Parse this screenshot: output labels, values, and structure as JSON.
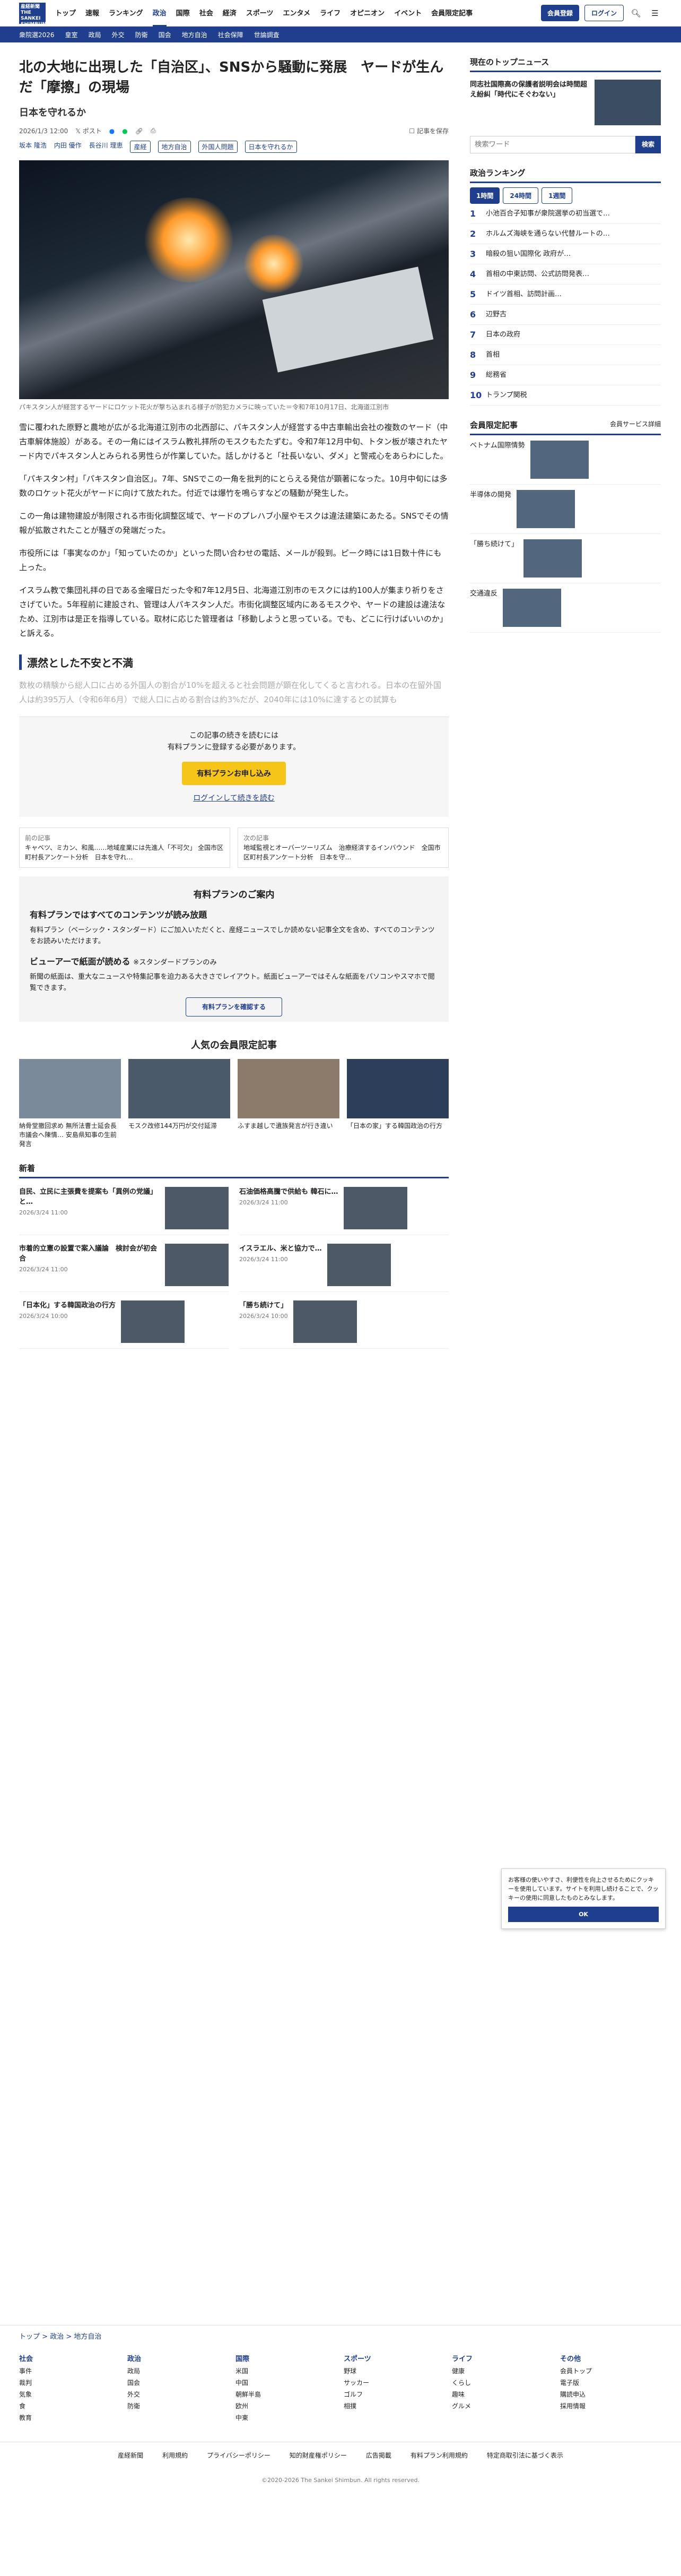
{
  "header": {
    "logo": "産経新聞 THE SANKEI SHIMBUN",
    "nav": [
      "トップ",
      "速報",
      "ランキング",
      "政治",
      "国際",
      "社会",
      "経済",
      "スポーツ",
      "エンタメ",
      "ライフ",
      "オピニオン",
      "イベント",
      "会員限定記事"
    ],
    "register": "会員登録",
    "login": "ログイン",
    "search": "検索",
    "menu": "メニュー"
  },
  "subnav": [
    "衆院選2026",
    "皇室",
    "政局",
    "外交",
    "防衛",
    "国会",
    "地方自治",
    "社会保障",
    "世論調査"
  ],
  "article": {
    "title": "北の大地に出現した「自治区」、SNSから騒動に発展　ヤードが生んだ「摩擦」の現場",
    "series": "日本を守れるか",
    "date": "2026/1/3 12:00",
    "post": "ポスト",
    "note": "記事を保存",
    "authors": [
      "坂本 隆浩",
      "内田 優作",
      "長谷川 理恵"
    ],
    "tags": [
      "産経",
      "地方自治",
      "外国人問題",
      "日本を守れるか"
    ],
    "caption": "パキスタン人が経営するヤードにロケット花火が撃ち込まれる様子が防犯カメラに映っていた＝令和7年10月17日、北海道江別市",
    "paragraphs": [
      "雪に覆われた原野と農地が広がる北海道江別市の北西部に、パキスタン人が経営する中古車輸出会社の複数のヤード（中古車解体施設）がある。その一角にはイスラム教礼拝所のモスクもたたずむ。令和7年12月中旬、トタン板が壊されたヤード内でパキスタン人とみられる男性らが作業していた。話しかけると「社長いない、ダメ」と警戒心をあらわにした。",
      "「パキスタン村」「パキスタン自治区」。7年、SNSでこの一角を批判的にとらえる発信が顕著になった。10月中旬には多数のロケット花火がヤードに向けて放たれた。付近では爆竹を鳴らすなどの騒動が発生した。",
      "この一角は建物建設が制限される市街化調整区域で、ヤードのプレハブ小屋やモスクは違法建築にあたる。SNSでその情報が拡散されたことが騒ぎの発端だった。",
      "市役所には「事実なのか」「知っていたのか」といった問い合わせの電話、メールが殺到。ピーク時には1日数十件にも上った。",
      "イスラム教で集団礼拝の日である金曜日だった令和7年12月5日、北海道江別市のモスクには約100人が集まり祈りをささげていた。5年程前に建設され、管理は人パキスタン人だ。市街化調整区域内にあるモスクや、ヤードの建設は違法なため、江別市は是正を指導している。取材に応じた管理者は「移動しようと思っている。でも、どこに行けばいいのか」と訴える。"
    ],
    "h2": "漂然とした不安と不満",
    "fade": "数枚の精験から総人口に占める外国人の割合が10%を超えると社会問題が顕在化してくると言われる。日本の在留外国人は約395万人（令和6年6月）で総人口に占める割合は約3%だが、2040年には10%に達するとの試算も"
  },
  "paywall": {
    "line1": "この記事の続きを読むには",
    "line2": "有料プランに登録する必要があります。",
    "cta": "有料プランお申し込み",
    "login": "ログインして続きを読む"
  },
  "related": {
    "left_label": "前の記事",
    "left": "キャベツ、ミカン、和風……地域産業には先進人「不可欠」 全国市区町村長アンケート分析　日本を守れ…",
    "right_label": "次の記事",
    "right": "地域監視とオーバーツーリズム　治療経済するインバウンド　全国市区町村長アンケート分析　日本を守…"
  },
  "plan": {
    "title": "有料プランのご案内",
    "h1": "有料プランではすべてのコンテンツが読み放題",
    "p1": "有料プラン（ベーシック・スタンダード）にご加入いただくと、産経ニュースでしか読めない記事全文を含め、すべてのコンテンツをお読みいただけます。",
    "h2": "ビューアーで紙面が読める",
    "h2sub": "※スタンダードプランのみ",
    "p2": "新聞の紙面は、重大なニュースや特集記事を迫力ある大きさでレイアウト。紙面ビューアーではそんな紙面をパソコンやスマホで閲覧できます。",
    "cta": "有料プランを確認する"
  },
  "popular": {
    "title": "人気の会員限定記事",
    "items": [
      "納骨堂撤回求め 無所法曹士延会長 市議会へ陳情… 安島県知事の生前発言",
      "モスク改修144万円が交付延滞",
      "ふすま越しで遺族発言が行き違い",
      "「日本の家」する韓国政治の行方"
    ]
  },
  "latest": {
    "title": "新着",
    "items": [
      {
        "t": "自民、立民に主張費を提案も「異例の党議」と…",
        "d": "2026/3/24 11:00"
      },
      {
        "t": "石油価格高騰で供給も 韓石に…",
        "d": "2026/3/24 11:00"
      },
      {
        "t": "市着的立憲の設置で案入議論　検討会が初会合",
        "d": "2026/3/24 11:00"
      },
      {
        "t": "イスラエル、米と協力で…",
        "d": "2026/3/24 11:00"
      },
      {
        "t": "「日本化」する韓国政治の行方",
        "d": "2026/3/24 10:00"
      },
      {
        "t": "「勝ち続けて」",
        "d": "2026/3/24 10:00"
      }
    ]
  },
  "sidebar": {
    "topnews_title": "現在のトップニュース",
    "topnews": "同志社国際高の保護者説明会は時間超え紛糾「時代にそぐわない」",
    "search_placeholder": "検索ワード",
    "search_btn": "検索",
    "ranking_title": "政治ランキング",
    "rank_tabs": [
      "1時間",
      "24時間",
      "1週間"
    ],
    "ranking": [
      "小池百合子知事が衆院選挙の初当選で…",
      "ホルムズ海峡を通らない代替ルートの…",
      "暗殺の狙い国際化 政府が…",
      "首相の中東訪問、公式訪問発表…",
      "ドイツ首相、訪問計画…",
      "辺野古",
      "日本の政府",
      "首相",
      "総務省",
      "トランプ関税"
    ],
    "member_title": "会員限定記事",
    "member_more": "会員サービス詳細",
    "member": [
      "ベトナム国際情勢",
      "半導体の開発",
      "「勝ち続けて」",
      "交通違反"
    ]
  },
  "footer": {
    "breadcrumb": [
      "トップ",
      "政治",
      "地方自治"
    ],
    "cols": {
      "社会": [
        "事件",
        "裁判",
        "気象",
        "食",
        "教育"
      ],
      "政治": [
        "政局",
        "国会",
        "外交",
        "防衛"
      ],
      "国際": [
        "米国",
        "中国",
        "朝鮮半島",
        "欧州",
        "中東"
      ],
      "スポーツ": [
        "野球",
        "サッカー",
        "ゴルフ",
        "相撲"
      ],
      "ライフ": [
        "健康",
        "くらし",
        "趣味",
        "グルメ"
      ],
      "その他": [
        "会員トップ",
        "電子版",
        "購読申込",
        "採用情報"
      ]
    },
    "links": [
      "産経新聞",
      "利用規約",
      "プライバシーポリシー",
      "知的財産権ポリシー",
      "広告掲載",
      "有料プラン利用規約",
      "特定商取引法に基づく表示"
    ],
    "copyright": "©2020-2026 The Sankei Shimbun. All rights reserved."
  },
  "cookie": {
    "text": "お客様の使いやすさ、利便性を向上させるためにクッキーを使用しています。サイトを利用し続けることで、クッキーの使用に同意したものとみなします。",
    "ok": "OK"
  }
}
